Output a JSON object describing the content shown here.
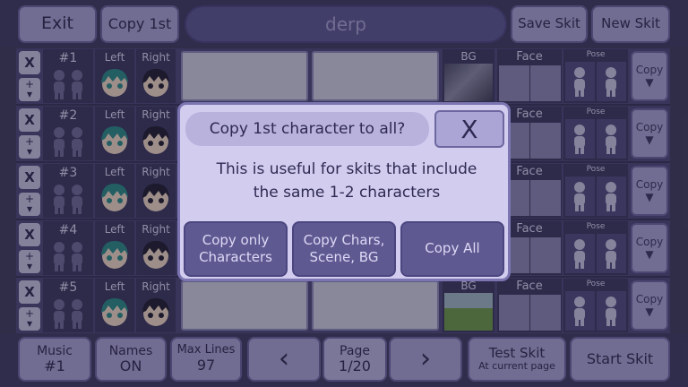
{
  "header": {
    "exit_label": "Exit",
    "copy_first_label": "Copy 1st",
    "skit_title": "derp",
    "save_label": "Save Skit",
    "new_label": "New Skit"
  },
  "row_labels": {
    "delete": "X",
    "left": "Left",
    "right": "Right",
    "bg": "BG",
    "face": "Face",
    "pose": "Pose",
    "copy": "Copy",
    "copy_arrow": "▼"
  },
  "rows": [
    {
      "number": "#1"
    },
    {
      "number": "#2"
    },
    {
      "number": "#3"
    },
    {
      "number": "#4"
    },
    {
      "number": "#5"
    }
  ],
  "footer": {
    "music_label": "Music",
    "music_value": "#1",
    "names_label": "Names",
    "names_value": "ON",
    "maxlines_label": "Max Lines",
    "maxlines_value": "97",
    "prev_icon": "‹",
    "page_label": "Page",
    "page_value": "1/20",
    "next_icon": "›",
    "test_label": "Test Skit",
    "test_sub": "At current page",
    "start_label": "Start Skit"
  },
  "dialog": {
    "title": "Copy 1st character to all?",
    "close_label": "X",
    "body_line1": "This is useful for skits that include",
    "body_line2": "the same 1-2 characters",
    "btn_chars_line1": "Copy only",
    "btn_chars_line2": "Characters",
    "btn_scene_line1": "Copy Chars,",
    "btn_scene_line2": "Scene, BG",
    "btn_all": "Copy All"
  },
  "colors": {
    "accent": "#a8a2d2",
    "panel": "#4c487a",
    "dialog_bg": "#d2cdef",
    "dialog_button": "#5f5992"
  }
}
